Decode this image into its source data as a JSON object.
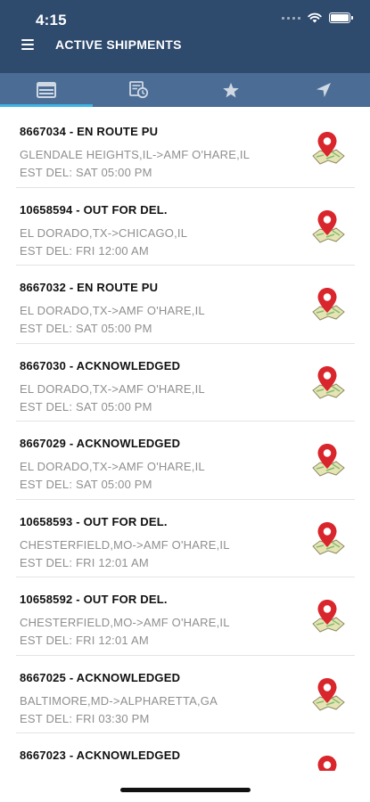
{
  "status_bar": {
    "time": "4:15"
  },
  "header": {
    "title": "ACTIVE SHIPMENTS"
  },
  "tabs": [
    {
      "icon": "list-icon",
      "active": true
    },
    {
      "icon": "history-icon",
      "active": false
    },
    {
      "icon": "star-icon",
      "active": false
    },
    {
      "icon": "navigation-icon",
      "active": false
    }
  ],
  "shipments": [
    {
      "title": "8667034 - EN ROUTE PU",
      "route": "GLENDALE HEIGHTS,IL->AMF O'HARE,IL",
      "eta": "EST DEL: SAT 05:00 PM"
    },
    {
      "title": "10658594 - OUT FOR DEL.",
      "route": "EL DORADO,TX->CHICAGO,IL",
      "eta": "EST DEL: FRI 12:00 AM"
    },
    {
      "title": "8667032 - EN ROUTE PU",
      "route": "EL DORADO,TX->AMF O'HARE,IL",
      "eta": "EST DEL: SAT 05:00 PM"
    },
    {
      "title": "8667030 - ACKNOWLEDGED",
      "route": "EL DORADO,TX->AMF O'HARE,IL",
      "eta": "EST DEL: SAT 05:00 PM"
    },
    {
      "title": "8667029 - ACKNOWLEDGED",
      "route": "EL DORADO,TX->AMF O'HARE,IL",
      "eta": "EST DEL: SAT 05:00 PM"
    },
    {
      "title": "10658593 - OUT FOR DEL.",
      "route": "CHESTERFIELD,MO->AMF O'HARE,IL",
      "eta": "EST DEL: FRI 12:01 AM"
    },
    {
      "title": "10658592 - OUT FOR DEL.",
      "route": "CHESTERFIELD,MO->AMF O'HARE,IL",
      "eta": "EST DEL: FRI 12:01 AM"
    },
    {
      "title": "8667025 - ACKNOWLEDGED",
      "route": "BALTIMORE,MD->ALPHARETTA,GA",
      "eta": "EST DEL: FRI 03:30 PM"
    },
    {
      "title": "8667023 - ACKNOWLEDGED",
      "route": "",
      "eta": ""
    }
  ],
  "colors": {
    "header": "#2e4a6d",
    "tab_bar": "#4b6d95",
    "tab_indicator": "#3fb4e8",
    "pin": "#d9262c"
  }
}
